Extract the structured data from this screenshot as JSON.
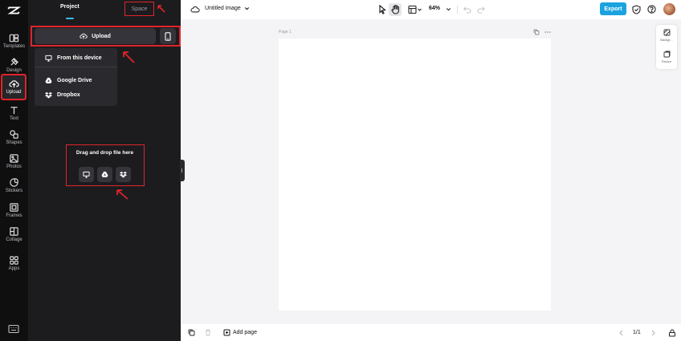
{
  "sidebar": {
    "items": [
      {
        "label": "Templates",
        "icon": "templates-icon"
      },
      {
        "label": "Design",
        "icon": "design-icon"
      },
      {
        "label": "Upload",
        "icon": "upload-icon",
        "active": true
      },
      {
        "label": "Text",
        "icon": "text-icon"
      },
      {
        "label": "Shapes",
        "icon": "shapes-icon"
      },
      {
        "label": "Photos",
        "icon": "photos-icon"
      },
      {
        "label": "Stickers",
        "icon": "stickers-icon"
      },
      {
        "label": "Frames",
        "icon": "frames-icon"
      },
      {
        "label": "Collage",
        "icon": "collage-icon"
      },
      {
        "label": "Apps",
        "icon": "apps-icon"
      }
    ]
  },
  "panel": {
    "tabs": [
      {
        "label": "Project"
      },
      {
        "label": "Space"
      }
    ],
    "upload_label": "Upload",
    "dropdown": [
      {
        "label": "From this device",
        "icon": "monitor-icon"
      },
      {
        "label": "Google Drive",
        "icon": "google-drive-icon"
      },
      {
        "label": "Dropbox",
        "icon": "dropbox-icon"
      }
    ],
    "drop_zone_title": "Drag and drop file here"
  },
  "topbar": {
    "title": "Untitled image",
    "zoom": "64%",
    "export_label": "Export"
  },
  "canvas": {
    "page_label": "Page 1",
    "right_tools": [
      {
        "label": "Backgr...",
        "icon": "background-icon"
      },
      {
        "label": "Resize",
        "icon": "resize-icon"
      }
    ]
  },
  "bottombar": {
    "add_page_label": "Add page",
    "pager": "1/1"
  },
  "colors": {
    "accent": "#1ba3e0",
    "annotation": "#e0242a",
    "panel_bg": "#1c1c1f",
    "rail_bg": "#0f0f10"
  }
}
